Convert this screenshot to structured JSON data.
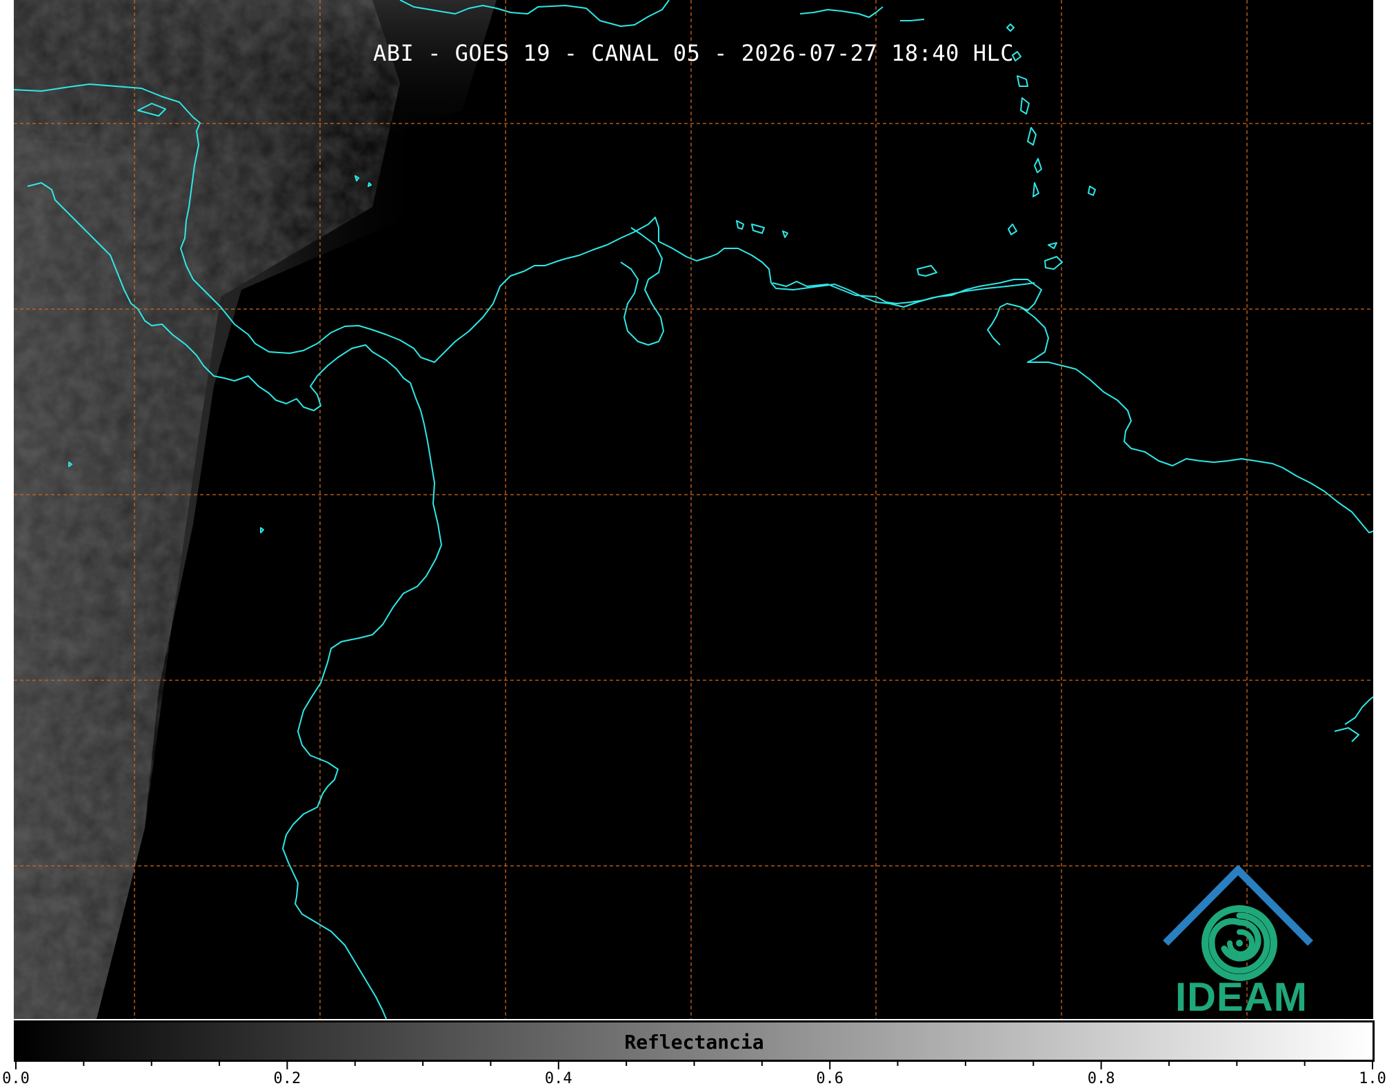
{
  "title": "ABI - GOES 19 - CANAL 05 - 2026-07-27 18:40 HLC",
  "colorbar": {
    "label": "Reflectancia",
    "range": [
      0.0,
      1.0
    ],
    "colormap": "grayscale (black to white)",
    "major_ticks": [
      {
        "value": 0.0,
        "label": "0.0"
      },
      {
        "value": 0.2,
        "label": "0.2"
      },
      {
        "value": 0.4,
        "label": "0.4"
      },
      {
        "value": 0.6,
        "label": "0.6"
      },
      {
        "value": 0.8,
        "label": "0.8"
      },
      {
        "value": 1.0,
        "label": "1.0"
      }
    ],
    "minor_tick_step": 0.05
  },
  "map": {
    "background": "#000000",
    "coastline_color": "#2ee8e8",
    "gridline_color": "#d2691e",
    "gridline_style": "dashed"
  },
  "logo": {
    "text": "IDEAM",
    "colors": {
      "roof": "#2a7fc0",
      "swirl": "#1fa87a",
      "text": "#1fa87a"
    }
  }
}
